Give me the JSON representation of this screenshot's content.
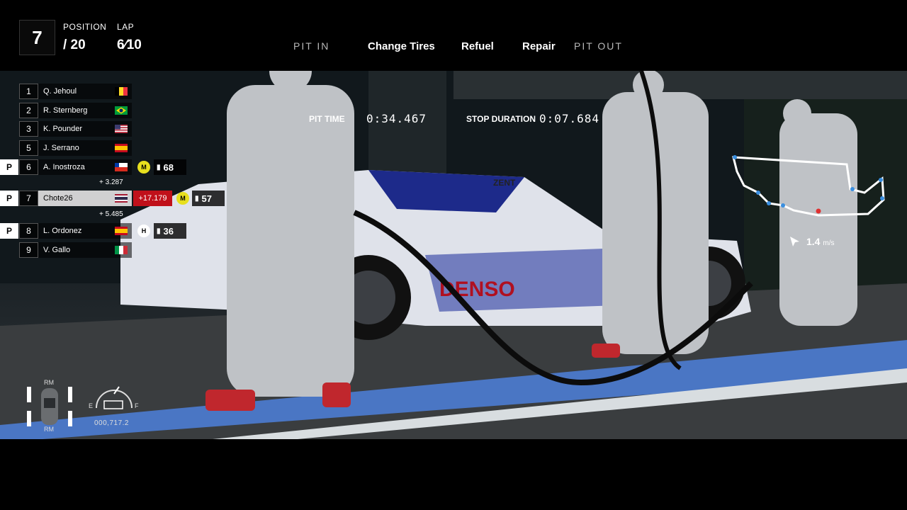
{
  "hud": {
    "position_label": "POSITION",
    "position_current": "7",
    "position_total": "/ 20",
    "lap_label": "LAP",
    "lap_value": "6⁄10"
  },
  "pit_menu": {
    "pit_in": "PIT IN",
    "change_tires": "Change Tires",
    "refuel": "Refuel",
    "repair": "Repair",
    "pit_out": "PIT OUT"
  },
  "pit_timing": {
    "pit_time_label": "PIT TIME",
    "pit_time_value": "0:34.467",
    "stop_duration_label": "STOP DURATION",
    "stop_duration_value": "0:07.684"
  },
  "leaderboard": [
    {
      "pos": "1",
      "name": "Q. Jehoul",
      "flag": "belgium"
    },
    {
      "pos": "2",
      "name": "R. Sternberg",
      "flag": "brazil"
    },
    {
      "pos": "3",
      "name": "K. Pounder",
      "flag": "usa"
    },
    {
      "pos": "5",
      "name": "J. Serrano",
      "flag": "spain"
    },
    {
      "pos": "6",
      "name": "A. Inostroza",
      "flag": "chile",
      "pit": "P",
      "tyre": "M",
      "fuel": "68"
    },
    {
      "pos": "7",
      "name": "Chote26",
      "flag": "thailand",
      "pit": "P",
      "tyre": "M",
      "fuel": "57",
      "delta": "+17.179",
      "player": true
    },
    {
      "pos": "8",
      "name": "L. Ordonez",
      "flag": "spain",
      "pit": "P",
      "tyre": "H",
      "fuel": "36"
    },
    {
      "pos": "9",
      "name": "V. Gallo",
      "flag": "italy"
    }
  ],
  "gaps": {
    "ahead": "+ 3.287",
    "behind": "+ 5.485"
  },
  "gauges": {
    "tyre_front_label": "RM",
    "tyre_rear_label": "RM",
    "fuel_empty": "E",
    "fuel_full": "F",
    "odometer": "000,717.2",
    "speed_value": "1.4",
    "speed_unit": "m/s"
  },
  "colors": {
    "accent_red": "#c0101a",
    "tyre_medium": "#e7df1e",
    "map_line": "#ffffff",
    "map_dot": "#3a8fe0"
  }
}
